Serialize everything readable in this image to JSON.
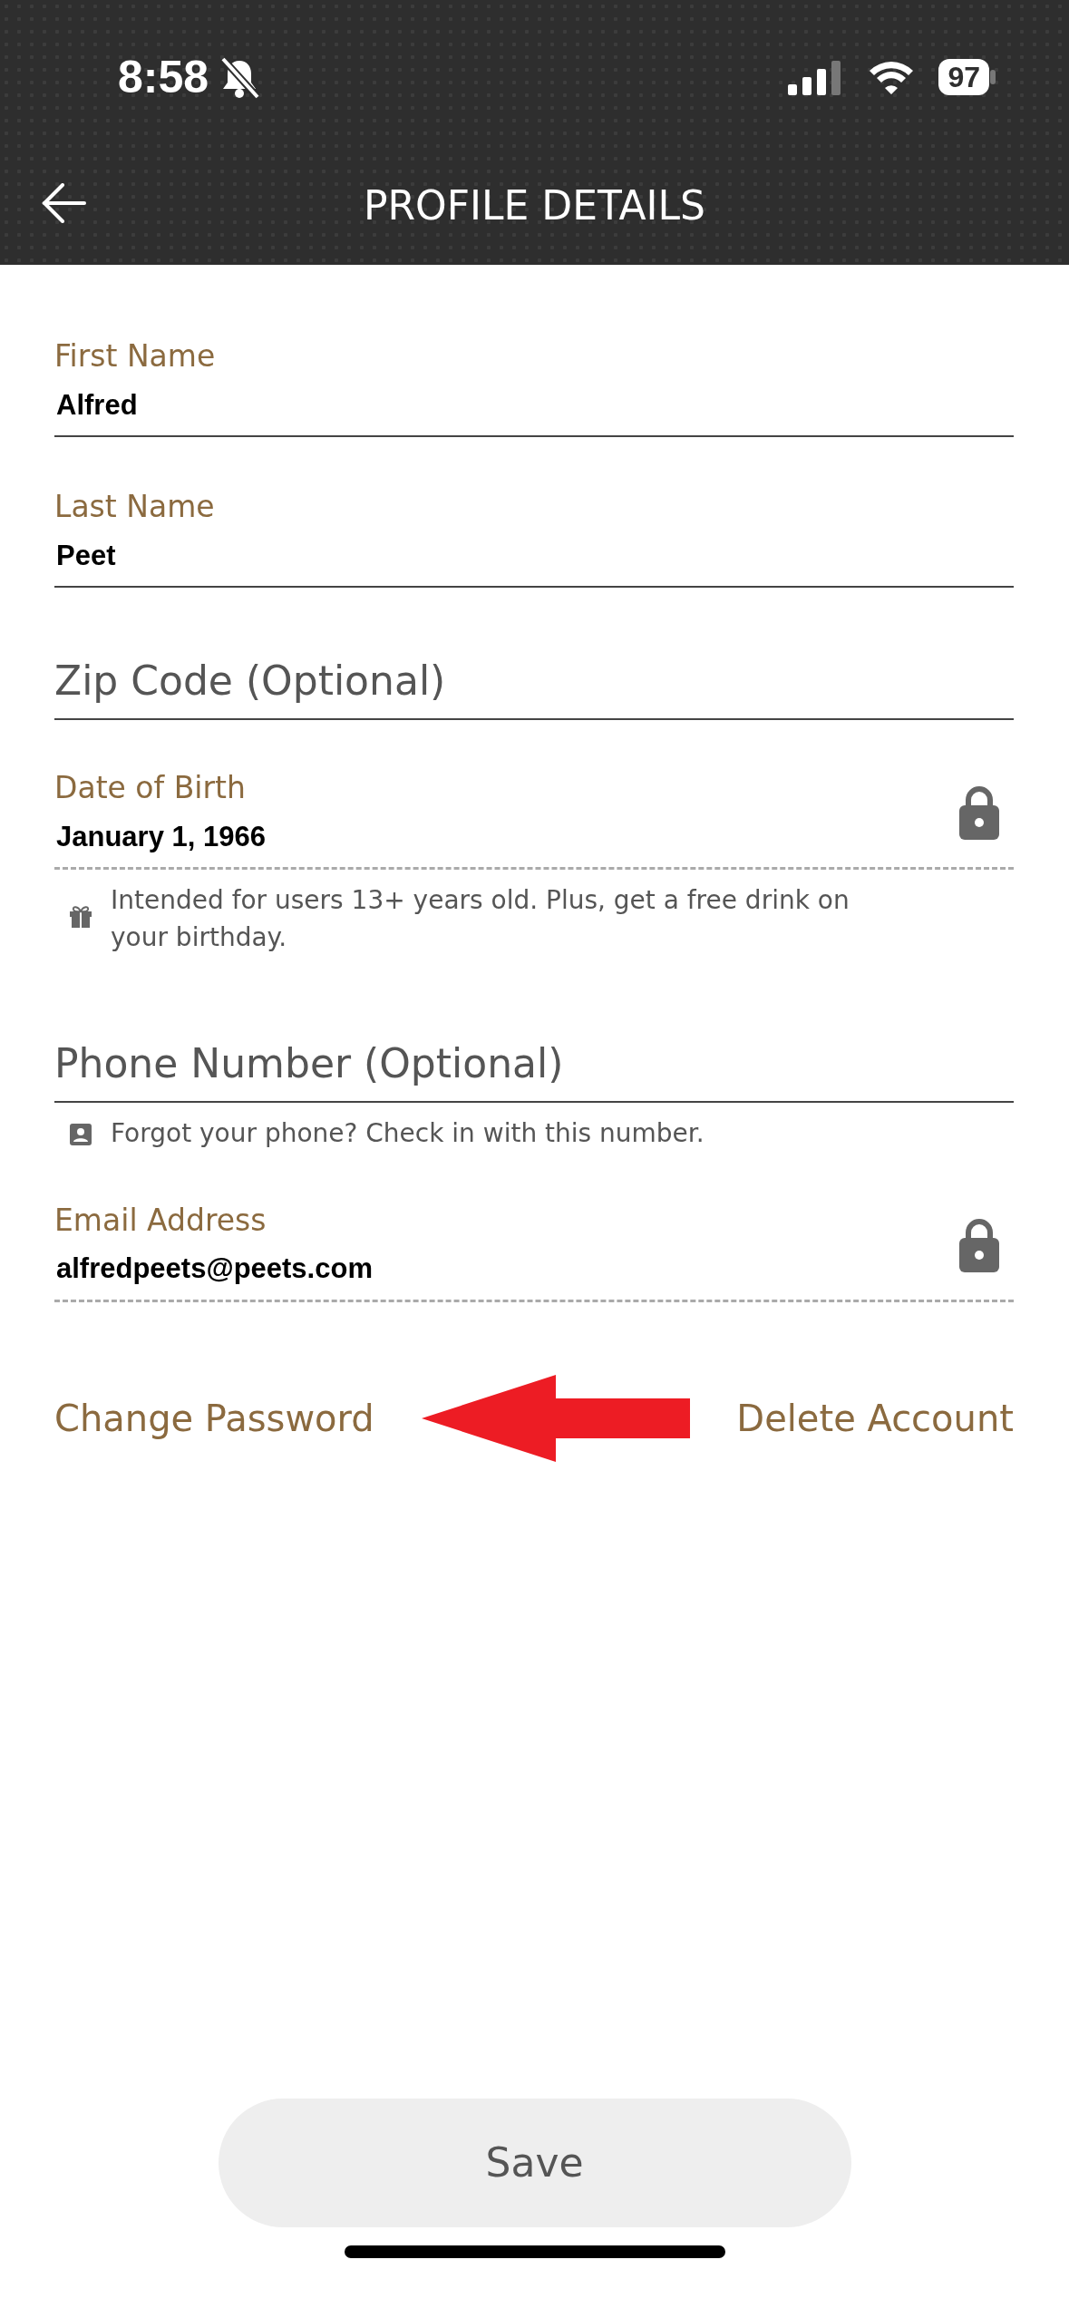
{
  "status_bar": {
    "time": "8:58",
    "silent": true,
    "battery": "97"
  },
  "header": {
    "title": "PROFILE DETAILS"
  },
  "fields": [
    {
      "kind": "filled",
      "label": "First Name",
      "value": "Alfred",
      "locked": false
    },
    {
      "kind": "filled",
      "label": "Last Name",
      "value": "Peet",
      "locked": false
    },
    {
      "kind": "empty",
      "placeholder": "Zip Code (Optional)",
      "locked": false
    },
    {
      "kind": "filled",
      "label": "Date of Birth",
      "value": "January 1, 1966",
      "locked": true,
      "help": {
        "text": "Intended for users 13+ years old. Plus, get a free drink on your birthday."
      }
    },
    {
      "kind": "empty",
      "placeholder": "Phone Number (Optional)",
      "locked": false,
      "help": {
        "text": "Forgot your phone? Check in with this number."
      }
    },
    {
      "kind": "filled",
      "label": "Email Address",
      "value": "alfredpeets@peets.com",
      "locked": true
    }
  ],
  "links": [
    "Change Password",
    "Delete Account"
  ],
  "save_button": {
    "label": "Save",
    "disabled": true
  }
}
